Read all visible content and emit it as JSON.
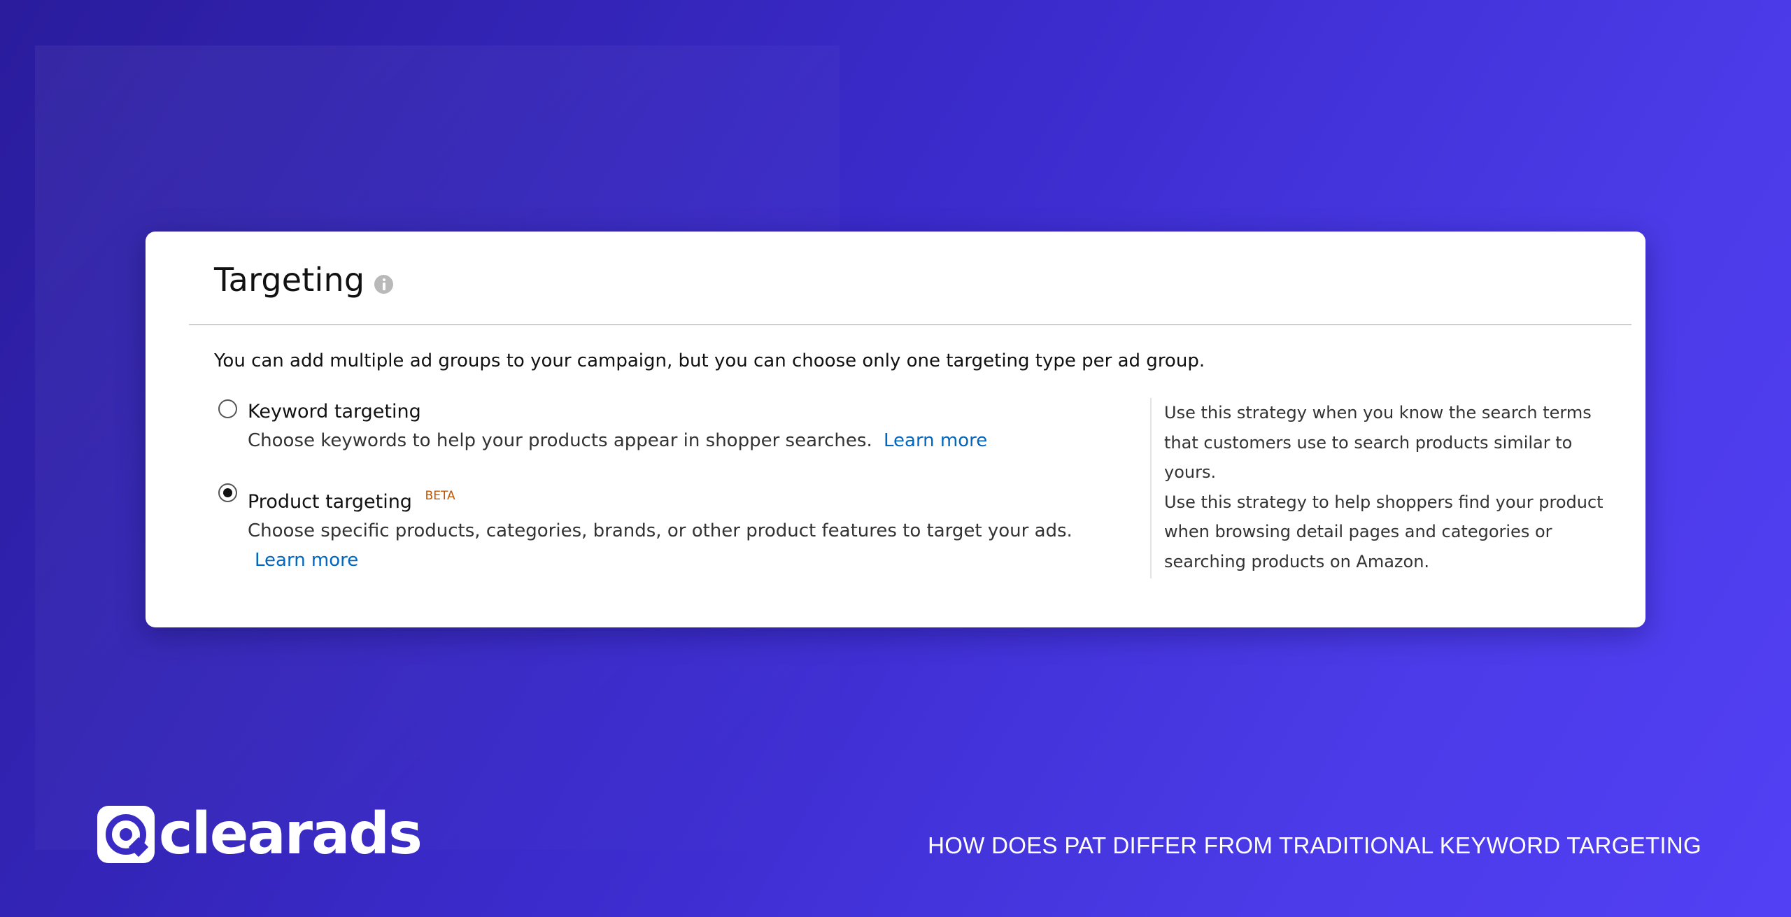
{
  "card": {
    "title": "Targeting",
    "intro": "You can add multiple ad groups to your campaign, but you can choose only one targeting type per ad group.",
    "options": [
      {
        "label": "Keyword targeting",
        "badge": "",
        "description": "Choose keywords to help your products appear in shopper searches.",
        "link": "Learn more",
        "selected": false
      },
      {
        "label": "Product targeting",
        "badge": "BETA",
        "description": "Choose specific products, categories, brands, or other product features to target your ads.",
        "link": "Learn more",
        "selected": true
      }
    ],
    "help": [
      "Use this strategy when you know the search terms that customers use to search products similar to yours.",
      "Use this strategy to help shoppers find your product when browsing detail pages and categories or searching products on Amazon."
    ]
  },
  "brand": {
    "name": "clearads",
    "icon": "at-sign-logo-icon"
  },
  "footer": {
    "caption": "HOW DOES PAT DIFFER FROM TRADITIONAL KEYWORD TARGETING"
  },
  "colors": {
    "background_start": "#2a1c9c",
    "background_end": "#5240f5",
    "link": "#0066c0",
    "badge": "#c45500"
  }
}
